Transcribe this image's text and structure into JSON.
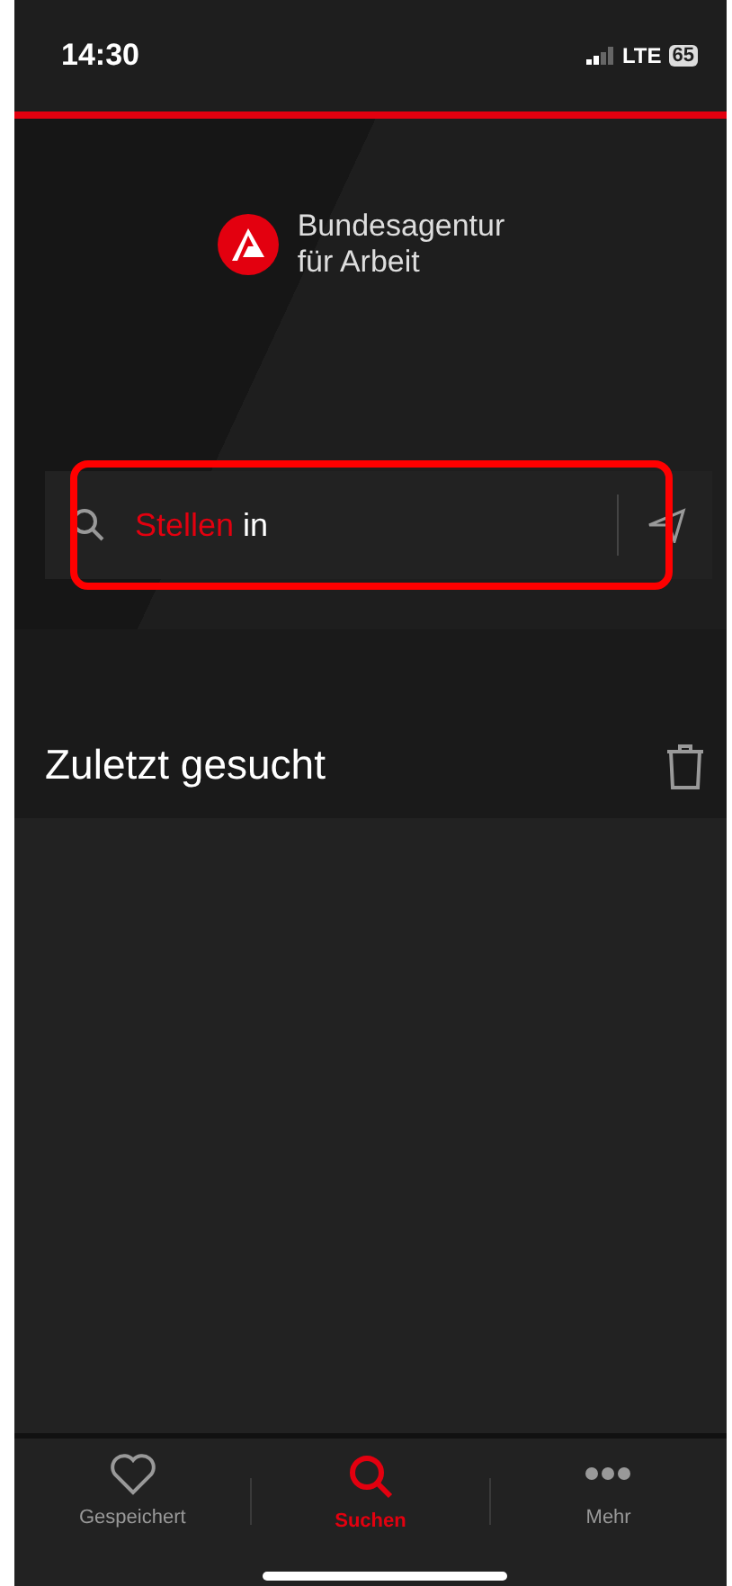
{
  "status_bar": {
    "time": "14:30",
    "network": "LTE",
    "battery": "65"
  },
  "logo": {
    "line_1": "Bundesagentur",
    "line_2": "für Arbeit"
  },
  "search": {
    "label": "Stellen",
    "value": "in",
    "highlighted": true
  },
  "recent": {
    "title": "Zuletzt gesucht"
  },
  "tabs": [
    {
      "label": "Gespeichert",
      "kind": "heart",
      "selected": false
    },
    {
      "label": "Suchen",
      "kind": "search",
      "selected": true
    },
    {
      "label": "Mehr",
      "kind": "more",
      "selected": false
    }
  ]
}
